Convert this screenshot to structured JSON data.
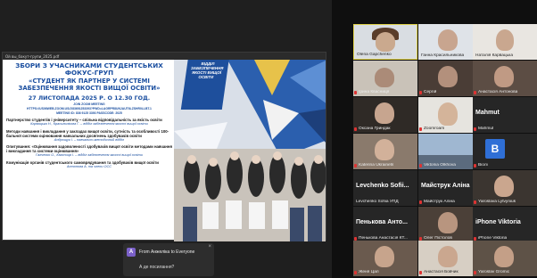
{
  "doc": {
    "filename": "Ой вы_бакут-групи_2025.pdf",
    "title": "ЗБОРИ З УЧАСНИКАМИ СТУДЕНТСЬКИХ ФОКУС-ГРУП",
    "subtitle": "«СТУДЕНТ ЯК ПАРТНЕР У СИСТЕМІ ЗАБЕЗПЕЧЕННЯ ЯКОСТІ ВИЩОЇ ОСВІТИ»",
    "date": "27 ЛИСТОПАДА 2025 Р. О 12.30 ГОД.",
    "zoom_line1": "JOIN ZOOM MEETING",
    "zoom_line2": "HTTPS://US06WEB.ZOOM.US/J/83691253393?PWD=LAGRPR8UNJAUT6LZSHR0LLBT.1",
    "zoom_line3": "MEETING ID: 836 9125 3393   PASSCODE: 2025",
    "items": [
      {
        "text": "Партнерство студентів і університету – спільна відповідальність за якість освіти",
        "by": "Карвацька Н., Красильнікова Г. – відділ забезпечення якості вищої освіти"
      },
      {
        "text": "Методи навчання і викладання у закладах вищої освіти, сутність та особливості 100-бальної системи оцінювання навчальних досягнень здобувачів освіти",
        "by": "Андрощук І. – навчально-методичний відділ"
      },
      {
        "text": "Опитування: «Оцінювання задоволеності здобувачів вищої освіти методами навчання і викладання та системи оцінювання»",
        "by": "Галченко О., Квасниця І. – відділ забезпечення якості вищої освіти"
      },
      {
        "text": "Комунікація органів студентського самоврядування та здобувачів вищої освіти",
        "by": "Антонова А. та члени ОСС"
      }
    ],
    "banner": "ВІДДІЛ ЗАБЕЗПЕЧЕННЯ ЯКОСТІ ВИЩОЇ ОСВІТИ"
  },
  "chat": {
    "avatar": "А",
    "from": "From Анжеліка to Everyone",
    "message": "А де посилання?",
    "close": "×"
  },
  "gallery": [
    {
      "name": "Olena Gapchenko"
    },
    {
      "name": "Ганна Красильникова"
    },
    {
      "name": "Наталія Карвацька"
    },
    {
      "name": "Ірина Квасниця"
    },
    {
      "name": "Сергій"
    },
    {
      "name": "Анастасія Антонова"
    },
    {
      "name": "Оксана Гриндак"
    },
    {
      "name": "Zoomroam"
    },
    {
      "name": "Mahmut",
      "big": "Mahmut"
    },
    {
      "name": "Katerina Ukrainets"
    },
    {
      "name": "Viktoriia Olkhova"
    },
    {
      "name": "Віолі",
      "initial": "В"
    },
    {
      "name": "Levchenko Sofiia УПД",
      "big": "Levchenko Sofii..."
    },
    {
      "name": "Майструк Аліна",
      "big": "Майструк Аліна"
    },
    {
      "name": "Yaroslava Lytvyniuk"
    },
    {
      "name": "Пенькова Анастасія КТ...",
      "big": "Пенькова Анто..."
    },
    {
      "name": "Олег Пістолов"
    },
    {
      "name": "iPhone Viktoria",
      "big": "iPhone Viktoria"
    },
    {
      "name": "Женя Цап"
    },
    {
      "name": "Анастасія Бовчик"
    },
    {
      "name": "Yaroslav Gromic"
    }
  ]
}
